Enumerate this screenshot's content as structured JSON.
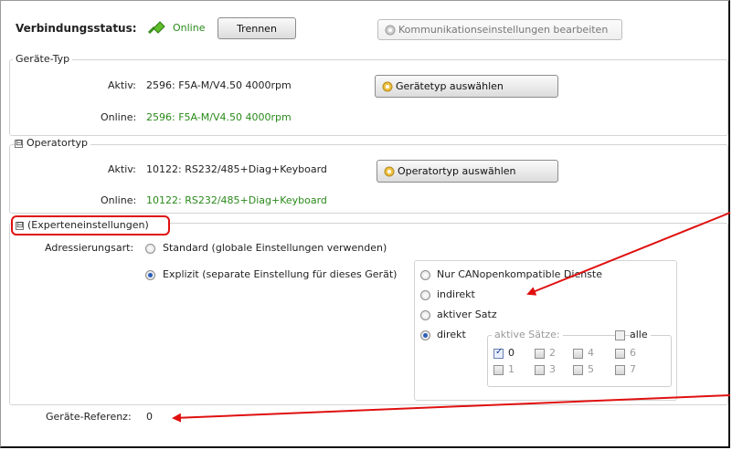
{
  "status": {
    "label": "Verbindungsstatus:",
    "state": "Online",
    "disconnect_button": "Trennen",
    "comm_settings_button": "Kommunikationseinstellungen bearbeiten"
  },
  "device_type": {
    "legend": "Geräte-Typ",
    "active_label": "Aktiv:",
    "active_value": "2596: F5A-M/V4.50 4000rpm",
    "online_label": "Online:",
    "online_value": "2596: F5A-M/V4.50 4000rpm",
    "select_button": "Gerätetyp auswählen"
  },
  "operator_type": {
    "expander": "⊟",
    "legend": "Operatortyp",
    "active_label": "Aktiv:",
    "active_value": "10122: RS232/485+Diag+Keyboard",
    "online_label": "Online:",
    "online_value": "10122: RS232/485+Diag+Keyboard",
    "select_button": "Operatortyp auswählen"
  },
  "expert": {
    "expander": "⊟",
    "legend": "(Experteneinstellungen)",
    "addressing_label": "Adressierungsart:",
    "option_standard": "Standard (globale Einstellungen verwenden)",
    "option_explicit": "Explizit (separate Einstellung für dieses Gerät)",
    "sub_options": {
      "canopen": "Nur CANopenkompatible Dienste",
      "indirect": "indirekt",
      "active_set": "aktiver Satz",
      "direct": "direkt"
    },
    "active_sets_legend": "aktive Sätze:",
    "all_label": "alle",
    "sets": [
      "0",
      "2",
      "4",
      "6",
      "1",
      "3",
      "5",
      "7"
    ],
    "device_ref_label": "Geräte-Referenz:",
    "device_ref_value": "0"
  },
  "colors": {
    "online_green": "#2a8a1a",
    "annotation_red": "#e01010"
  }
}
